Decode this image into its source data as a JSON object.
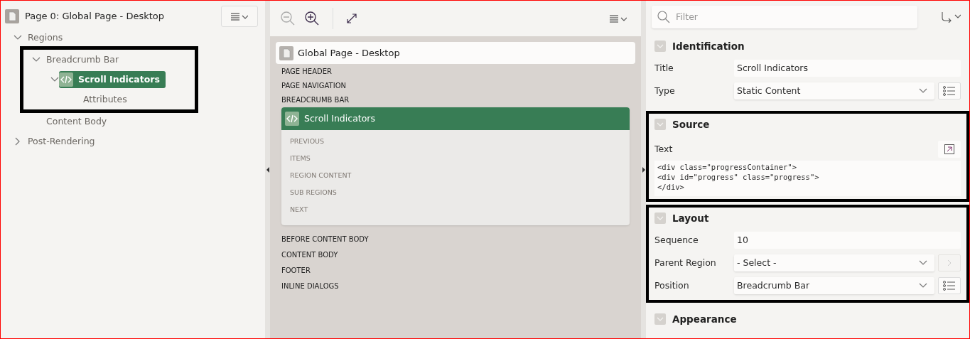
{
  "tree": {
    "title": "Page 0: Global Page - Desktop",
    "items": [
      {
        "label": "Regions",
        "expanded": true,
        "selected": false,
        "highlighted": false,
        "children": [
          {
            "label": "Breadcrumb Bar",
            "expanded": true,
            "selected": false,
            "highlighted": true,
            "children": [
              {
                "label": "Scroll Indicators",
                "expanded": true,
                "selected": true,
                "highlighted": false,
                "children": [
                  {
                    "label": "Attributes",
                    "selected": false,
                    "highlighted": false
                  }
                ]
              }
            ]
          },
          {
            "label": "Content Body",
            "selected": false,
            "highlighted": false
          }
        ]
      },
      {
        "label": "Post-Rendering",
        "expanded": false,
        "selected": false,
        "highlighted": false
      }
    ]
  },
  "layout_editor": {
    "toolbar": [
      {
        "kind": "zoom-out",
        "disabled": true
      },
      {
        "kind": "zoom-in",
        "disabled": false
      },
      {
        "kind": "expand",
        "disabled": false
      }
    ],
    "page_title": "Global Page - Desktop",
    "positions_before": [
      "PAGE HEADER",
      "PAGE NAVIGATION",
      "BREADCRUMB BAR"
    ],
    "region": {
      "title": "Scroll Indicators",
      "selected": true,
      "slots": [
        "PREVIOUS",
        "ITEMS",
        "REGION CONTENT",
        "SUB REGIONS",
        "NEXT"
      ]
    },
    "positions_after": [
      "BEFORE CONTENT BODY",
      "CONTENT BODY",
      "FOOTER",
      "INLINE DIALOGS"
    ]
  },
  "property_editor": {
    "filter": {
      "placeholder": "Filter"
    },
    "sections": [
      {
        "title": "Identification",
        "highlighted": false,
        "fields": [
          {
            "kind": "text",
            "label": "Title",
            "value": "Scroll Indicators"
          },
          {
            "kind": "select",
            "label": "Type",
            "value": "Static Content",
            "button": {
              "kind": "list",
              "disabled": false
            }
          }
        ]
      },
      {
        "title": "Source",
        "highlighted": true,
        "fields": [
          {
            "kind": "code",
            "label": "Text",
            "lines": [
              "<div class=\"progressContainer\">",
              "<div id=\"progress\" class=\"progress\">",
              "</div>"
            ]
          }
        ]
      },
      {
        "title": "Layout",
        "highlighted": true,
        "fields": [
          {
            "kind": "text",
            "label": "Sequence",
            "value": "10"
          },
          {
            "kind": "select",
            "label": "Parent Region",
            "value": "- Select -",
            "button": {
              "kind": "go",
              "disabled": true
            }
          },
          {
            "kind": "select",
            "label": "Position",
            "value": "Breadcrumb Bar",
            "button": {
              "kind": "list",
              "disabled": false
            }
          }
        ]
      },
      {
        "title": "Appearance",
        "highlighted": false
      }
    ]
  }
}
